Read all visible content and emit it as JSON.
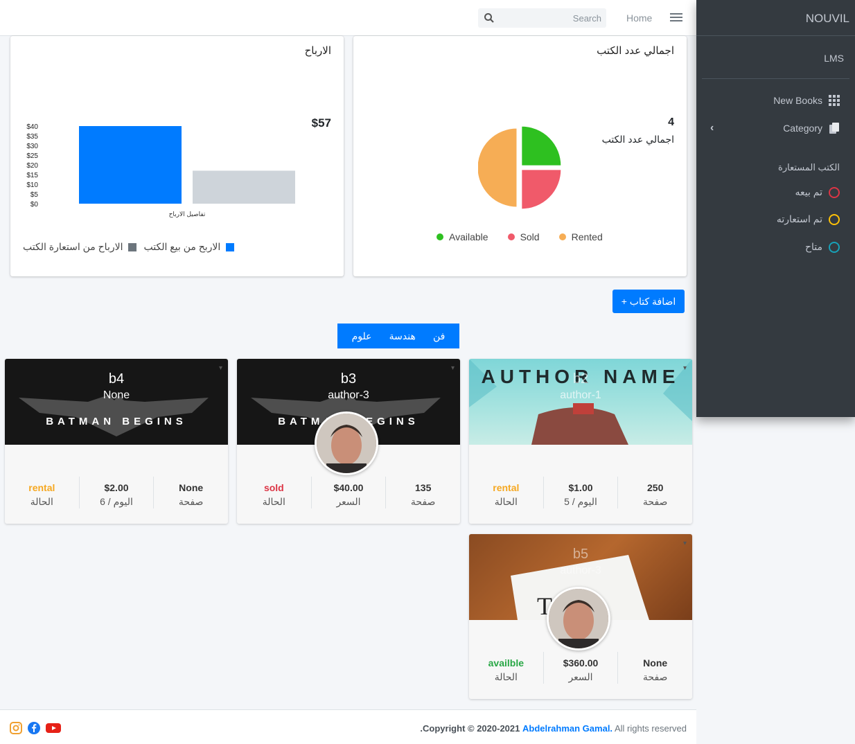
{
  "nav": {
    "home": "Home",
    "search_placeholder": "Search"
  },
  "sidebar": {
    "brand": "NOUVIL",
    "lms": "LMS",
    "items": [
      {
        "label": "New Books",
        "icon": "grid-icon"
      },
      {
        "label": "Category",
        "icon": "copy-icon"
      }
    ],
    "header": "الكتب المستعارة",
    "status_items": [
      {
        "label": "تم بيعه",
        "color": "#dc3545"
      },
      {
        "label": "تم استعارته",
        "color": "#ffc107"
      },
      {
        "label": "متاح",
        "color": "#17a2b8"
      }
    ]
  },
  "earnings": {
    "title": "الارباح",
    "total": "$57",
    "legend_sale": "الاربح من بيع الكتب",
    "legend_rent": "الارباح من استعارة الكتب"
  },
  "books_total": {
    "title": "اجمالي عدد الكتب",
    "count": "4",
    "subtitle": "اجمالي عدد الكتب"
  },
  "chart_data": [
    {
      "type": "bar",
      "xlabel": "تفاصيل الارباح",
      "categories": [
        ""
      ],
      "series": [
        {
          "name": "الاربح من بيع الكتب",
          "values": [
            40
          ],
          "color": "#007bff"
        },
        {
          "name": "الارباح من استعارة الكتب",
          "values": [
            17
          ],
          "color": "#ced4da"
        }
      ],
      "yticks": [
        "$40",
        "$35",
        "$30",
        "$25",
        "$20",
        "$15",
        "$10",
        "$5",
        "$0"
      ],
      "ylim": [
        0,
        40
      ],
      "legend": "bottom"
    },
    {
      "type": "pie",
      "categories": [
        "Available",
        "Sold",
        "Rented"
      ],
      "values": [
        1,
        1,
        2
      ],
      "colors": [
        "#2ec020",
        "#f05a6a",
        "#f6ad55"
      ],
      "legend": "bottom"
    }
  ],
  "add_button": "+ اضافة كتاب",
  "tabs": [
    "فن",
    "هندسة",
    "علوم"
  ],
  "books": [
    {
      "title": "b2",
      "author": "author-1",
      "pages": "250",
      "pages_label": "صفحة",
      "price": "$1.00",
      "price_label": "5 / اليوم",
      "status": "rental",
      "status_label": "الحالة",
      "status_color": "#f6a821"
    },
    {
      "title": "b3",
      "author": "author-3",
      "pages": "135",
      "pages_label": "صفحة",
      "price": "$40.00",
      "price_label": "السعر",
      "status": "sold",
      "status_label": "الحالة",
      "status_color": "#dc3545"
    },
    {
      "title": "b4",
      "author": "None",
      "pages": "None",
      "pages_label": "صفحة",
      "price": "$2.00",
      "price_label": "6 / اليوم",
      "status": "rental",
      "status_label": "الحالة",
      "status_color": "#f6a821"
    },
    {
      "title": "b5",
      "author": "author-3",
      "pages": "None",
      "pages_label": "صفحة",
      "price": "$360.00",
      "price_label": "السعر",
      "status": "availble",
      "status_label": "الحالة",
      "status_color": "#28a745"
    }
  ],
  "covers": {
    "b2_text": "AUTHOR NAME",
    "batman_text": "BATMAN BEGINS"
  },
  "footer": {
    "copyright": "Copyright © 2020-2021",
    "author": "Abdelrahman Gamal.",
    "rights": "All rights reserved"
  }
}
